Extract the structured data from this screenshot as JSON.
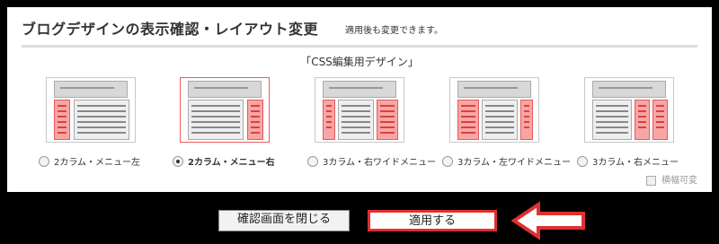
{
  "header": {
    "title": "ブログデザインの表示確認・レイアウト変更",
    "hint": "適用後も変更できます。"
  },
  "css_heading": "「CSS編集用デザイン」",
  "layouts": [
    {
      "label": "2カラム・メニュー左",
      "selected": false
    },
    {
      "label": "2カラム・メニュー右",
      "selected": true
    },
    {
      "label": "3カラム・右ワイドメニュー",
      "selected": false
    },
    {
      "label": "3カラム・左ワイドメニュー",
      "selected": false
    },
    {
      "label": "3カラム・右メニュー",
      "selected": false
    }
  ],
  "wide_checkbox_label": "横幅可変",
  "buttons": {
    "close": "確認画面を閉じる",
    "apply": "適用する"
  },
  "colors": {
    "accent_red": "#e03030",
    "menu_pink": "#f7a6a6"
  }
}
